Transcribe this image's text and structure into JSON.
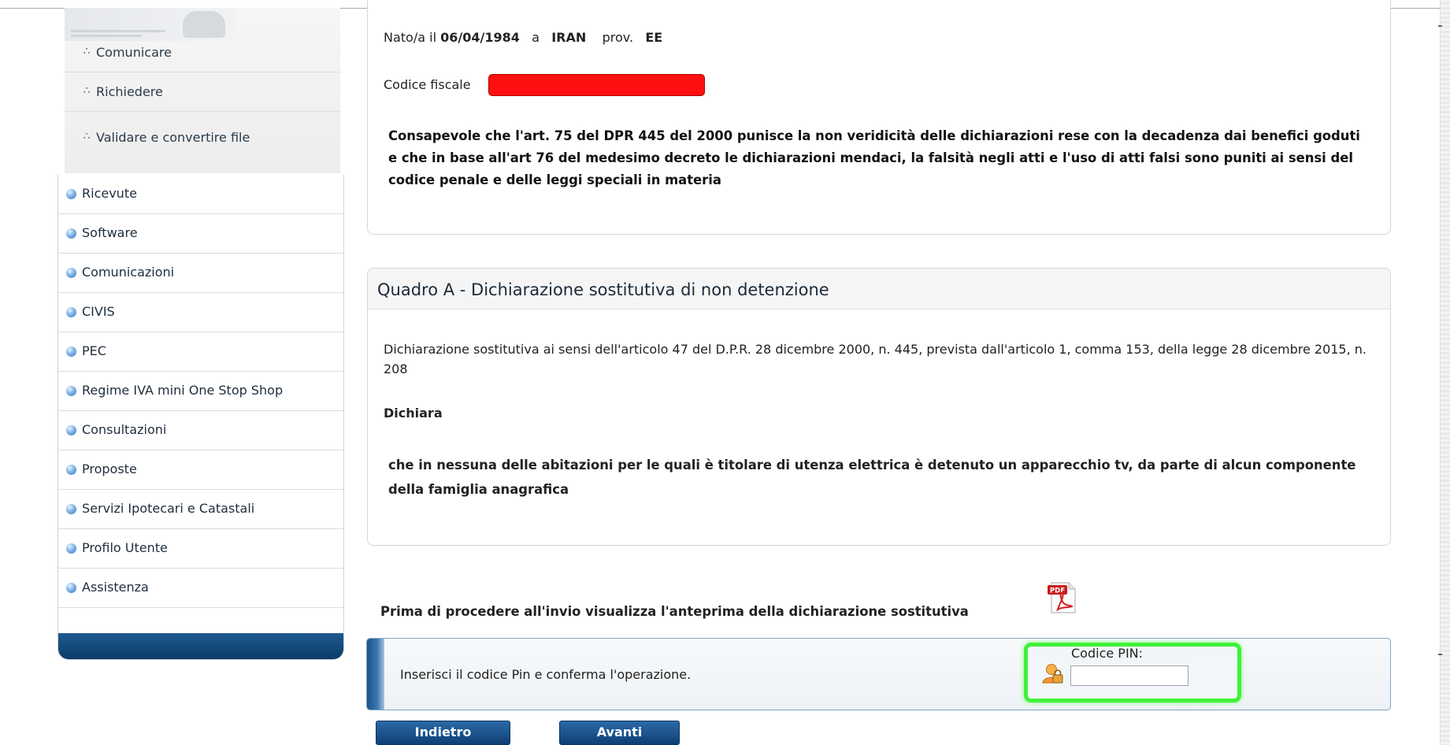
{
  "sidebar": {
    "sub_items": [
      {
        "label": "Comunicare"
      },
      {
        "label": "Richiedere"
      },
      {
        "label": "Validare e convertire file"
      }
    ],
    "items": [
      {
        "label": "Ricevute"
      },
      {
        "label": "Software"
      },
      {
        "label": "Comunicazioni"
      },
      {
        "label": "CIVIS"
      },
      {
        "label": "PEC"
      },
      {
        "label": "Regime IVA mini One Stop Shop"
      },
      {
        "label": "Consultazioni"
      },
      {
        "label": "Proposte"
      },
      {
        "label": "Servizi Ipotecari e Catastali"
      },
      {
        "label": "Profilo Utente"
      },
      {
        "label": "Assistenza"
      }
    ],
    "bullet_icon": "square-dots-bullet",
    "item_icon": "blue-sphere-bullet"
  },
  "personal": {
    "born_prefix": "Nato/a il",
    "birth_date": "06/04/1984",
    "at_word": "a",
    "birth_place": "IRAN",
    "prov_word": "prov.",
    "province": "EE",
    "fiscal_code_label": "Codice fiscale",
    "fiscal_code_redaction_color": "#ff1010",
    "awareness_text": "Consapevole che l'art. 75 del DPR 445 del 2000 punisce la non veridicità delle dichiarazioni rese con la decadenza dai benefici goduti e che in base all'art 76 del medesimo decreto le dichiarazioni mendaci, la falsità negli atti e l'uso di atti falsi sono puniti ai sensi del codice penale e delle leggi speciali in materia"
  },
  "quadro_a": {
    "title": "Quadro A - Dichiarazione sostitutiva di non detenzione",
    "description": "Dichiarazione sostitutiva ai sensi dell'articolo 47 del D.P.R. 28 dicembre 2000, n. 445, prevista dall'articolo 1, comma 153, della legge 28 dicembre 2015, n. 208",
    "declares_label": "Dichiara",
    "declaration_text": "che in nessuna delle abitazioni per le quali è titolare di utenza elettrica è detenuto un apparecchio tv, da parte di alcun componente della famiglia anagrafica"
  },
  "preview": {
    "text": "Prima di procedere all'invio visualizza l'anteprima della dichiarazione sostitutiva",
    "icon": "pdf-icon",
    "pdf_badge": "PDF"
  },
  "pin": {
    "instruction": "Inserisci il codice Pin e conferma l'operazione.",
    "label": "Codice PIN:",
    "value": "",
    "icon": "user-lock-icon",
    "highlight_color": "#3ff23a"
  },
  "buttons": {
    "back_label": "Indietro",
    "next_label": "Avanti"
  },
  "colors": {
    "menu_footer": "#0c3a68",
    "button": "#1a5089",
    "accent_blue": "#3d79b3"
  }
}
